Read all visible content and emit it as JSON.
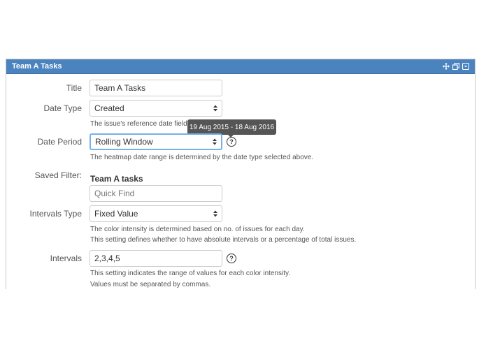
{
  "panel": {
    "title": "Team A Tasks",
    "header_icons": [
      "move-icon",
      "restore-icon",
      "dropdown-icon"
    ]
  },
  "form": {
    "title": {
      "label": "Title",
      "value": "Team A Tasks"
    },
    "date_type": {
      "label": "Date Type",
      "selected": "Created",
      "help": "The issue's reference date field."
    },
    "date_period": {
      "label": "Date Period",
      "selected": "Rolling Window",
      "help": "The heatmap date range is determined by the date type selected above.",
      "tooltip": "19 Aug 2015 - 18 Aug 2016"
    },
    "saved_filter": {
      "label": "Saved Filter:",
      "name": "Team A tasks",
      "placeholder": "Quick Find"
    },
    "intervals_type": {
      "label": "Intervals Type",
      "selected": "Fixed Value",
      "help_1": "The color intensity is determined based on no. of issues for each day.",
      "help_2": "This setting defines whether to have absolute intervals or a percentage of total issues."
    },
    "intervals": {
      "label": "Intervals",
      "value": "2,3,4,5",
      "help_1": "This setting indicates the range of values for each color intensity.",
      "help_2": "Values must be separated by commas."
    }
  },
  "help_icon_glyph": "?",
  "colors": {
    "header": "#4b83bf",
    "focus": "#75b0ea",
    "tooltip": "#555555"
  }
}
